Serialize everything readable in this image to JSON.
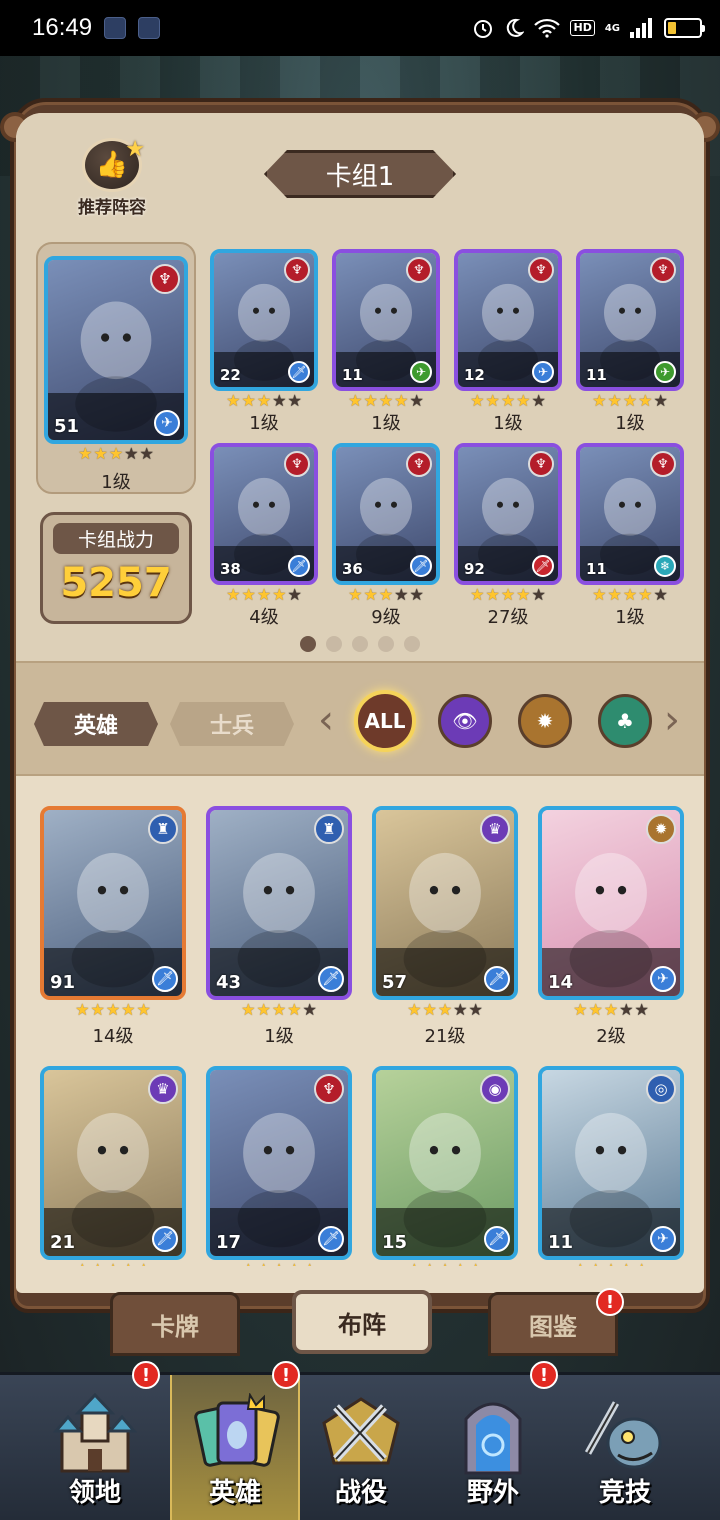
{
  "status_bar": {
    "time": "16:49",
    "hd_label": "HD",
    "network_label": "4G",
    "battery_level": 0.25
  },
  "recommend": {
    "label": "推荐阵容",
    "icon": "thumbs-up-icon"
  },
  "deck": {
    "title": "卡组1",
    "power_label": "卡组战力",
    "power_value": "5257",
    "leader": {
      "level": "51",
      "stars": 3,
      "rank": "1级",
      "faction": "red-demon",
      "role": "plane",
      "rarity": "blue"
    },
    "cards": [
      {
        "level": "22",
        "stars": 3,
        "rank": "1级",
        "faction": "red-demon",
        "role": "sword",
        "rarity": "blue"
      },
      {
        "level": "11",
        "stars": 4,
        "rank": "1级",
        "faction": "red-demon",
        "role": "plane-green",
        "rarity": "purple"
      },
      {
        "level": "12",
        "stars": 4,
        "rank": "1级",
        "faction": "red-demon",
        "role": "plane",
        "rarity": "purple"
      },
      {
        "level": "11",
        "stars": 4,
        "rank": "1级",
        "faction": "red-demon",
        "role": "plane-green",
        "rarity": "purple"
      },
      {
        "level": "38",
        "stars": 4,
        "rank": "4级",
        "faction": "red-demon",
        "role": "sword",
        "rarity": "purple"
      },
      {
        "level": "36",
        "stars": 3,
        "rank": "9级",
        "faction": "red-demon",
        "role": "sword",
        "rarity": "blue"
      },
      {
        "level": "92",
        "stars": 4,
        "rank": "27级",
        "faction": "red-demon",
        "role": "sword-red",
        "rarity": "purple"
      },
      {
        "level": "11",
        "stars": 4,
        "rank": "1级",
        "faction": "red-demon",
        "role": "snowflake",
        "rarity": "purple"
      }
    ],
    "page_count": 5,
    "active_page": 0
  },
  "filter": {
    "tabs": [
      {
        "label": "英雄",
        "active": true
      },
      {
        "label": "士兵",
        "active": false
      }
    ],
    "all_label": "ALL",
    "chips": [
      "eye-faction-icon",
      "sun-faction-icon",
      "tree-faction-icon"
    ]
  },
  "heroes": [
    {
      "level": "91",
      "stars": 5,
      "rank": "14级",
      "faction": "blue-castle",
      "role": "sword",
      "rarity": "orange"
    },
    {
      "level": "43",
      "stars": 4,
      "rank": "1级",
      "faction": "blue-castle",
      "role": "sword",
      "rarity": "purple"
    },
    {
      "level": "57",
      "stars": 3,
      "rank": "21级",
      "faction": "purple-crown",
      "role": "sword",
      "rarity": "blue"
    },
    {
      "level": "14",
      "stars": 3,
      "rank": "2级",
      "faction": "orange-sun",
      "role": "plane",
      "rarity": "blue"
    },
    {
      "level": "21",
      "stars": 0,
      "rank": "",
      "faction": "purple-crown",
      "role": "sword",
      "rarity": "blue"
    },
    {
      "level": "17",
      "stars": 0,
      "rank": "",
      "faction": "red-demon",
      "role": "sword",
      "rarity": "blue"
    },
    {
      "level": "15",
      "stars": 0,
      "rank": "",
      "faction": "purple-eye",
      "role": "sword",
      "rarity": "blue"
    },
    {
      "level": "11",
      "stars": 0,
      "rank": "",
      "faction": "blue-swirl",
      "role": "plane",
      "rarity": "blue"
    }
  ],
  "sub_tabs": [
    {
      "label": "卡牌",
      "active": false,
      "badge": false
    },
    {
      "label": "布阵",
      "active": true,
      "badge": false
    },
    {
      "label": "图鉴",
      "active": false,
      "badge": true,
      "badge_text": "!"
    }
  ],
  "nav": [
    {
      "label": "领地",
      "icon": "castle-icon",
      "badge": true,
      "active": false
    },
    {
      "label": "英雄",
      "icon": "hero-cards-icon",
      "badge": true,
      "active": true
    },
    {
      "label": "战役",
      "icon": "crossed-swords-icon",
      "badge": false,
      "active": false
    },
    {
      "label": "野外",
      "icon": "portal-icon",
      "badge": true,
      "active": false
    },
    {
      "label": "竞技",
      "icon": "fish-warrior-icon",
      "badge": false,
      "active": false
    }
  ],
  "colors": {
    "accent": "#6e5647",
    "gold": "#ffcf3a",
    "panel": "#e8dcc6",
    "badge": "#e22922"
  }
}
